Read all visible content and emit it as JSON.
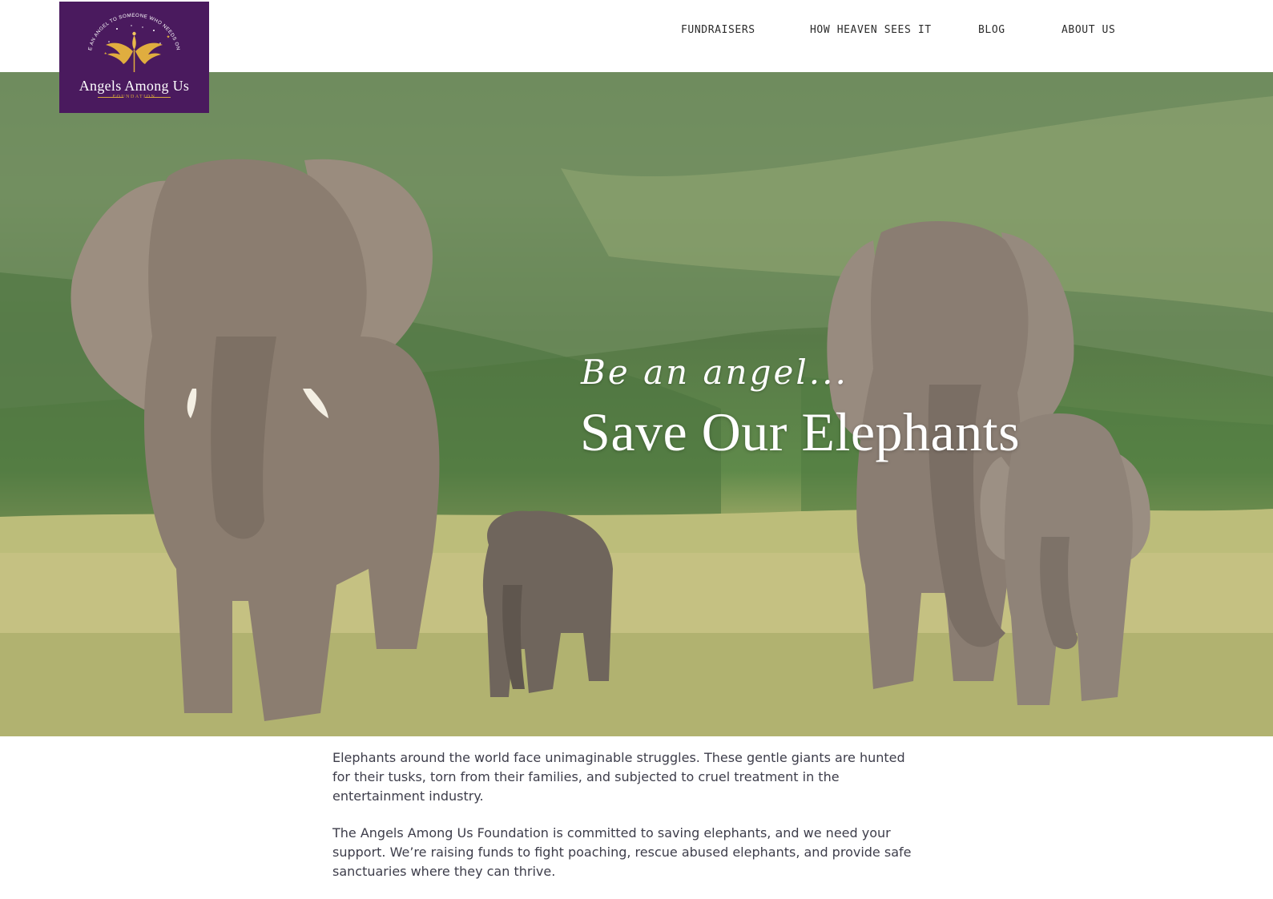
{
  "logo": {
    "arc_text": "BE AN ANGEL TO SOMEONE WHO NEEDS ONE",
    "name": "Angels Among Us",
    "subtitle": "FOUNDATION",
    "background_color": "#4a1a5e",
    "accent_color": "#d9a83c",
    "icon": "angel-wings-icon"
  },
  "nav": {
    "items": [
      {
        "label": "FUNDRAISERS"
      },
      {
        "label": "HOW HEAVEN SEES IT"
      },
      {
        "label": "BLOG"
      },
      {
        "label": "ABOUT US"
      }
    ]
  },
  "hero": {
    "script_line": "Be an angel...",
    "title": "Save Our Elephants",
    "image": "elephant-family-photo"
  },
  "content": {
    "paragraphs": [
      "Elephants around the world face unimaginable struggles. These gentle giants are hunted for their tusks, torn from their families, and subjected to cruel treatment in the entertainment industry.",
      "The Angels Among Us Foundation is committed to saving elephants, and we need your support. We’re raising funds to fight poaching, rescue abused elephants, and provide safe sanctuaries where they can thrive."
    ]
  }
}
